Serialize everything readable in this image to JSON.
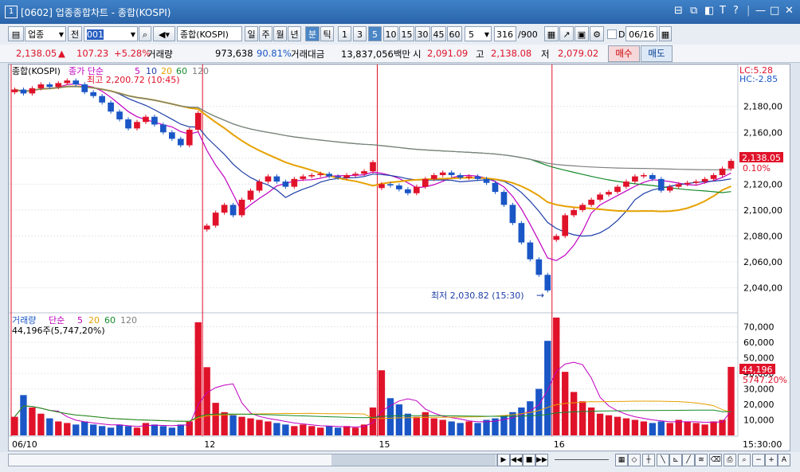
{
  "window": {
    "number": "1",
    "title": "[0602] 업종종합차트 - 종합(KOSPI)",
    "controls": [
      "⊟",
      "⧉",
      "◧",
      "T",
      "?",
      "|",
      "—",
      "□",
      "✕"
    ]
  },
  "toolbar": {
    "market_select": "업종",
    "prev_label": "전",
    "code_input": "001",
    "index_name": "종합(KOSPI)",
    "period_tabs": [
      "일",
      "주",
      "월",
      "년",
      "분",
      "틱"
    ],
    "period_active": "분",
    "interval_buttons": [
      "1",
      "3",
      "5",
      "10",
      "15",
      "30",
      "45",
      "60"
    ],
    "interval_active": "5",
    "interval_select": "5",
    "count_value": "316",
    "count_total": "/900",
    "d_label": "D",
    "date_value": "06/16"
  },
  "quote": {
    "price": "2,138.05",
    "change_arrow": "▲",
    "change": "107.23",
    "change_pct": "+5.28%",
    "volume_label": "거래량",
    "volume": "973,638",
    "volume_ratio": "90.81%",
    "amount_label": "거래대금",
    "amount": "13,837,056백만",
    "open_label": "시",
    "open": "2,091.09",
    "high_label": "고",
    "high": "2,138.08",
    "low_label": "저",
    "low": "2,079.02",
    "buy_label": "매수",
    "sell_label": "매도"
  },
  "chart_data": {
    "type": "candlestick+volume",
    "price_panel": {
      "legend": {
        "name": "종합(KOSPI)",
        "ma_label": "종가 단순",
        "ma_periods": [
          "5",
          "10",
          "20",
          "60",
          "120"
        ],
        "ma_colors": [
          "#c000c0",
          "#1e3ea8",
          "#e6a100",
          "#138a2a",
          "#808080"
        ]
      },
      "high_note": "최고 2,200.72 (10:45)",
      "low_note": "최저 2,030.82 (15:30)",
      "lc": "LC:5.28",
      "hc": "HC:-2.85",
      "y_ticks": [
        2180,
        2160,
        2140,
        2120,
        2100,
        2080,
        2060,
        2040
      ],
      "y_tick_labels": [
        "2,180,00",
        "2,160,00",
        "2,140,00",
        "2,120,00",
        "2,100,00",
        "2,080,00",
        "2,060,00",
        "2,040,00"
      ],
      "ylim": [
        2025,
        2205
      ],
      "last_price_label": "2,138.05",
      "last_pct_label": "0.10%",
      "closes": [
        2193,
        2190,
        2194,
        2197,
        2195,
        2198,
        2200,
        2197,
        2191,
        2188,
        2183,
        2176,
        2170,
        2163,
        2168,
        2172,
        2166,
        2160,
        2155,
        2150,
        2162,
        2175,
        2088,
        2098,
        2104,
        2096,
        2108,
        2115,
        2122,
        2126,
        2122,
        2118,
        2124,
        2126,
        2127,
        2128,
        2126,
        2125,
        2127,
        2128,
        2130,
        2137,
        2120,
        2119,
        2116,
        2113,
        2118,
        2124,
        2127,
        2129,
        2127,
        2125,
        2126,
        2124,
        2121,
        2114,
        2104,
        2090,
        2075,
        2062,
        2050,
        2038,
        2080,
        2096,
        2100,
        2104,
        2108,
        2112,
        2114,
        2118,
        2122,
        2126,
        2127,
        2124,
        2115,
        2118,
        2120,
        2121,
        2122,
        2124,
        2127,
        2132,
        2138
      ]
    },
    "volume_panel": {
      "legend": {
        "name": "거래량",
        "ma_label": "단순",
        "ma_periods": [
          "5",
          "20",
          "60",
          "120"
        ]
      },
      "summary": "44,196주(5,747,20%)",
      "y_ticks": [
        10000,
        20000,
        30000,
        40000,
        50000,
        60000,
        70000
      ],
      "y_tick_labels": [
        "10,000",
        "20,000",
        "30,000",
        "40,000",
        "50,000",
        "60,000",
        "70,000"
      ],
      "ylim": [
        0,
        76000
      ],
      "last_volume_label": "44,196",
      "last_volume_pct": "5747.20%",
      "volumes": [
        12000,
        26000,
        18000,
        14000,
        11000,
        9000,
        8000,
        7000,
        9000,
        7000,
        6000,
        5000,
        7000,
        6000,
        5000,
        8000,
        7000,
        6000,
        5000,
        7000,
        9000,
        73000,
        44000,
        21000,
        15000,
        13000,
        12000,
        11000,
        10000,
        9000,
        8000,
        7000,
        6000,
        7000,
        6000,
        5000,
        6000,
        5000,
        6000,
        5000,
        7000,
        18000,
        42000,
        24000,
        20000,
        14000,
        12000,
        15000,
        11000,
        10000,
        9000,
        8000,
        9000,
        8000,
        10000,
        11000,
        13000,
        15000,
        18000,
        22000,
        30000,
        61000,
        76000,
        41000,
        28000,
        22000,
        18000,
        14000,
        13000,
        12000,
        11000,
        10000,
        9000,
        8000,
        9000,
        8000,
        10000,
        9000,
        8000,
        7000,
        9000,
        10000,
        44196
      ]
    },
    "x_labels": [
      "06/10",
      "12",
      "15",
      "16"
    ],
    "time_label": "15:30:00"
  }
}
